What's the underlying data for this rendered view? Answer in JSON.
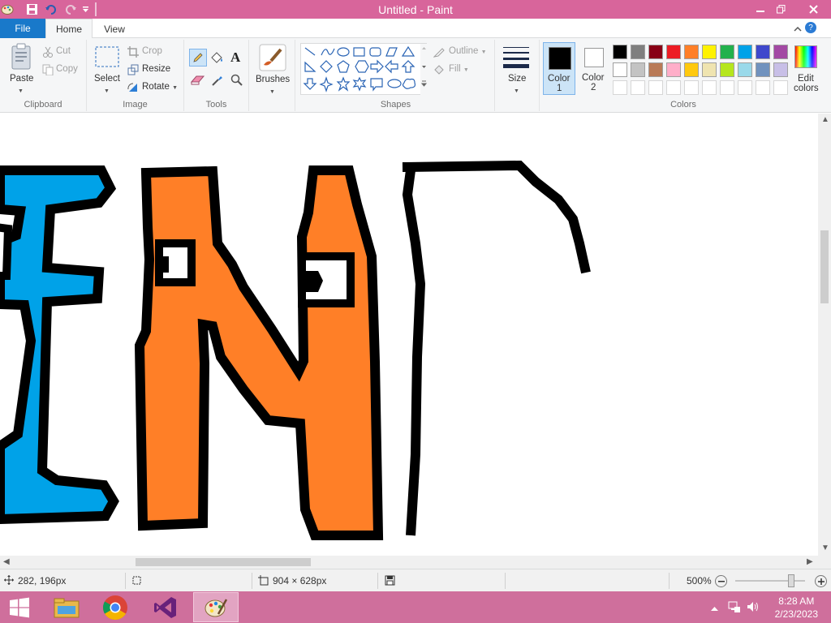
{
  "window": {
    "title": "Untitled - Paint"
  },
  "tabs": {
    "file": "File",
    "home": "Home",
    "view": "View"
  },
  "clipboard": {
    "paste": "Paste",
    "cut": "Cut",
    "copy": "Copy",
    "label": "Clipboard"
  },
  "image": {
    "select": "Select",
    "crop": "Crop",
    "resize": "Resize",
    "rotate": "Rotate",
    "label": "Image"
  },
  "tools": {
    "label": "Tools",
    "items": [
      "pencil-icon",
      "fill-bucket-icon",
      "text-icon",
      "eraser-icon",
      "color-picker-icon",
      "magnifier-icon"
    ]
  },
  "brushes": {
    "label": "Brushes"
  },
  "shapes": {
    "outline": "Outline",
    "fill": "Fill",
    "label": "Shapes"
  },
  "size": {
    "label": "Size"
  },
  "colors": {
    "color1_label_a": "Color",
    "color1_label_b": "1",
    "color2_label_a": "Color",
    "color2_label_b": "2",
    "edit_label_a": "Edit",
    "edit_label_b": "colors",
    "label": "Colors",
    "color1": "#000000",
    "color2": "#ffffff",
    "row1": [
      "#000000",
      "#7f7f7f",
      "#880015",
      "#ed1c24",
      "#ff7f27",
      "#fff200",
      "#22b14c",
      "#00a2e8",
      "#3f48cc",
      "#a349a4"
    ],
    "row2": [
      "#ffffff",
      "#c3c3c3",
      "#b97a57",
      "#ffaec9",
      "#ffc90e",
      "#efe4b0",
      "#b5e61d",
      "#99d9ea",
      "#7092be",
      "#c8bfe7"
    ]
  },
  "status": {
    "cursor": "282, 196px",
    "image_size": "904 × 628px",
    "zoom": "500%",
    "zoom_level_fraction": 0.8
  },
  "taskbar": {
    "time": "8:28 AM",
    "date": "2/23/2023"
  }
}
